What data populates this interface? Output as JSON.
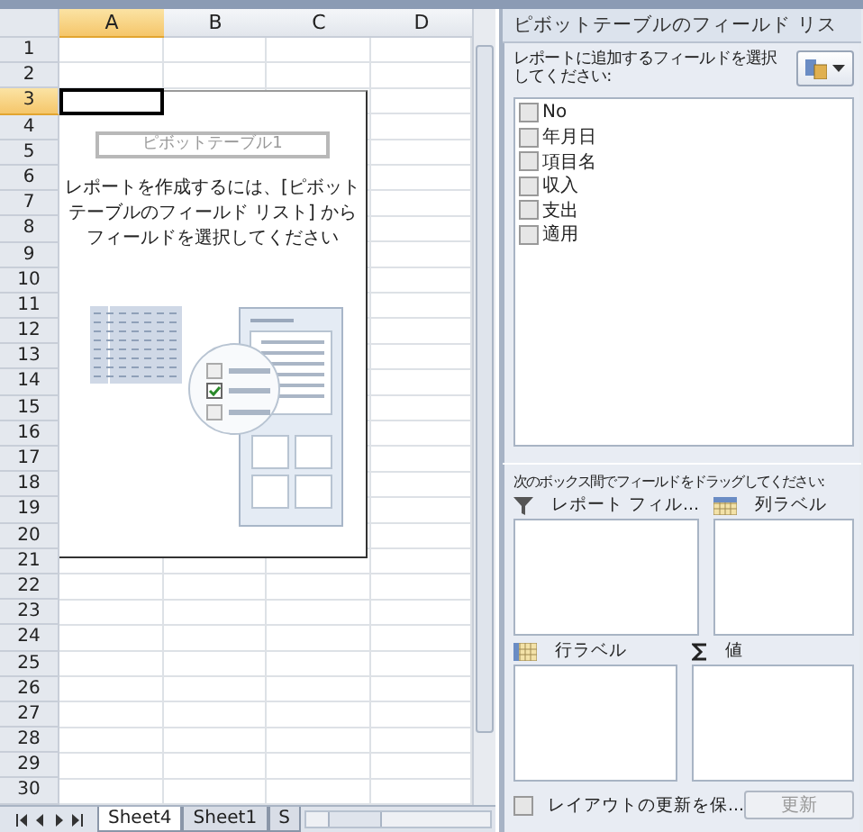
{
  "sheet": {
    "columns": [
      {
        "label": "A",
        "selected": true
      },
      {
        "label": "B",
        "selected": false
      },
      {
        "label": "C",
        "selected": false
      },
      {
        "label": "D",
        "selected": false
      }
    ],
    "rows": [
      {
        "label": "1",
        "selected": false
      },
      {
        "label": "2",
        "selected": false
      },
      {
        "label": "3",
        "selected": true
      },
      {
        "label": "4",
        "selected": false
      },
      {
        "label": "5",
        "selected": false
      },
      {
        "label": "6",
        "selected": false
      },
      {
        "label": "7",
        "selected": false
      },
      {
        "label": "8",
        "selected": false
      },
      {
        "label": "9",
        "selected": false
      },
      {
        "label": "10",
        "selected": false
      },
      {
        "label": "11",
        "selected": false
      },
      {
        "label": "12",
        "selected": false
      },
      {
        "label": "13",
        "selected": false
      },
      {
        "label": "14",
        "selected": false
      },
      {
        "label": "15",
        "selected": false
      },
      {
        "label": "16",
        "selected": false
      },
      {
        "label": "17",
        "selected": false
      },
      {
        "label": "18",
        "selected": false
      },
      {
        "label": "19",
        "selected": false
      },
      {
        "label": "20",
        "selected": false
      },
      {
        "label": "21",
        "selected": false
      },
      {
        "label": "22",
        "selected": false
      },
      {
        "label": "23",
        "selected": false
      },
      {
        "label": "24",
        "selected": false
      },
      {
        "label": "25",
        "selected": false
      },
      {
        "label": "26",
        "selected": false
      },
      {
        "label": "27",
        "selected": false
      },
      {
        "label": "28",
        "selected": false
      },
      {
        "label": "29",
        "selected": false
      },
      {
        "label": "30",
        "selected": false
      }
    ],
    "pivot_placeholder": {
      "name": "ピボットテーブル1",
      "message": "レポートを作成するには、[ピボットテーブルのフィールド リスト] からフィールドを選択してください"
    },
    "sheet_tabs": [
      {
        "label": "Sheet4",
        "selected": true
      },
      {
        "label": "Sheet1",
        "selected": false
      },
      {
        "label": "S",
        "selected": false
      }
    ]
  },
  "field_list": {
    "title": "ピボットテーブルのフィールド リス",
    "instruction": "レポートに追加するフィールドを選択してください:",
    "fields": [
      {
        "label": "No",
        "checked": false
      },
      {
        "label": "年月日",
        "checked": false
      },
      {
        "label": "項目名",
        "checked": false
      },
      {
        "label": "収入",
        "checked": false
      },
      {
        "label": "支出",
        "checked": false
      },
      {
        "label": "適用",
        "checked": false
      }
    ],
    "drag_instruction": "次のボックス間でフィールドをドラッグしてください:",
    "areas": [
      {
        "kind": "filter",
        "label": "レポート フィル..."
      },
      {
        "kind": "columns",
        "label": "列ラベル"
      },
      {
        "kind": "rows",
        "label": "行ラベル"
      },
      {
        "kind": "values",
        "label": "値"
      }
    ],
    "defer_update": {
      "label": "レイアウトの更新を保...",
      "checked": false
    },
    "update_button": {
      "label": "更新",
      "disabled": true
    }
  }
}
